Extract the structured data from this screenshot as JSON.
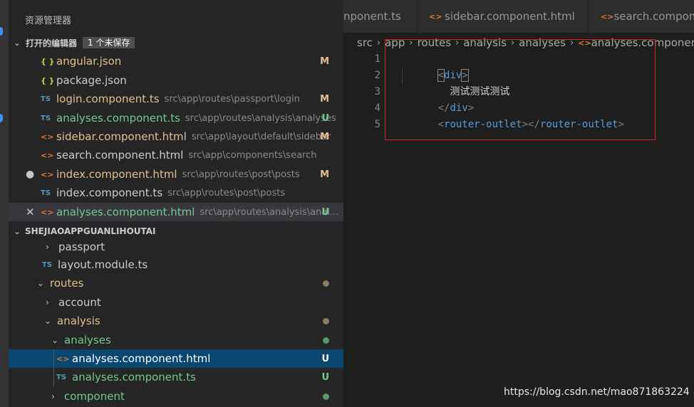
{
  "explorer": {
    "title": "资源管理器"
  },
  "open_editors": {
    "title": "打开的编辑器",
    "badge": "1 个未保存",
    "items": [
      {
        "icon": "{ }",
        "name": "angular.json",
        "path": "",
        "status": "M"
      },
      {
        "icon": "{ }",
        "name": "package.json",
        "path": "",
        "status": ""
      },
      {
        "icon": "TS",
        "name": "login.component.ts",
        "path": "src\\app\\routes\\passport\\login",
        "status": "M"
      },
      {
        "icon": "TS",
        "name": "analyses.component.ts",
        "path": "src\\app\\routes\\analysis\\analyses",
        "status": "U"
      },
      {
        "icon": "<>",
        "name": "sidebar.component.html",
        "path": "src\\app\\layout\\default\\sidebar",
        "status": "M"
      },
      {
        "icon": "<>",
        "name": "search.component.html",
        "path": "src\\app\\components\\search",
        "status": ""
      },
      {
        "icon": "<>",
        "name": "index.component.html",
        "path": "src\\app\\routes\\post\\posts",
        "status": "M"
      },
      {
        "icon": "TS",
        "name": "index.component.ts",
        "path": "src\\app\\routes\\post\\posts",
        "status": ""
      },
      {
        "icon": "<>",
        "name": "analyses.component.html",
        "path": "src\\app\\routes\\analysis\\anal...",
        "status": "U"
      }
    ]
  },
  "project": {
    "title": "SHEJIAOAPPGUANLIHOUTAI",
    "tree": [
      {
        "chev": "›",
        "icon": "",
        "name": "passport",
        "status": ""
      },
      {
        "chev": "",
        "icon": "TS",
        "name": "layout.module.ts",
        "status": ""
      },
      {
        "chev": "⌄",
        "icon": "",
        "name": "routes",
        "status": ""
      },
      {
        "chev": "›",
        "icon": "",
        "name": "account",
        "status": ""
      },
      {
        "chev": "⌄",
        "icon": "",
        "name": "analysis",
        "status": ""
      },
      {
        "chev": "⌄",
        "icon": "",
        "name": "analyses",
        "status": ""
      },
      {
        "chev": "",
        "icon": "<>",
        "name": "analyses.component.html",
        "status": "U"
      },
      {
        "chev": "",
        "icon": "TS",
        "name": "analyses.component.ts",
        "status": "U"
      },
      {
        "chev": "›",
        "icon": "",
        "name": "component",
        "status": ""
      }
    ]
  },
  "tabs": [
    {
      "icon": "",
      "label": "nponent.ts"
    },
    {
      "icon": "<>",
      "label": "sidebar.component.html"
    },
    {
      "icon": "<>",
      "label": "search.compone"
    }
  ],
  "breadcrumb": {
    "items": [
      "src",
      "app",
      "routes",
      "analysis",
      "analyses"
    ],
    "file_icon": "<>",
    "file": "analyses.component.h"
  },
  "editor": {
    "line_numbers": [
      "1",
      "2",
      "3",
      "4",
      "5"
    ],
    "lines": {
      "l1_open": "<",
      "l1_tag": "div",
      "l1_close": ">",
      "l2_text": "  测试测试测试",
      "l3_open": "</",
      "l3_tag": "div",
      "l3_close": ">",
      "l4_open1": "<",
      "l4_tag1": "router-outlet",
      "l4_mid": "></",
      "l4_tag2": "router-outlet",
      "l4_close": ">"
    }
  },
  "watermark": "https://blog.csdn.net/mao871863224",
  "colors": {
    "modified": "#e2c08d",
    "untracked": "#73c991",
    "selection": "#094771",
    "annotation": "#e02020"
  }
}
